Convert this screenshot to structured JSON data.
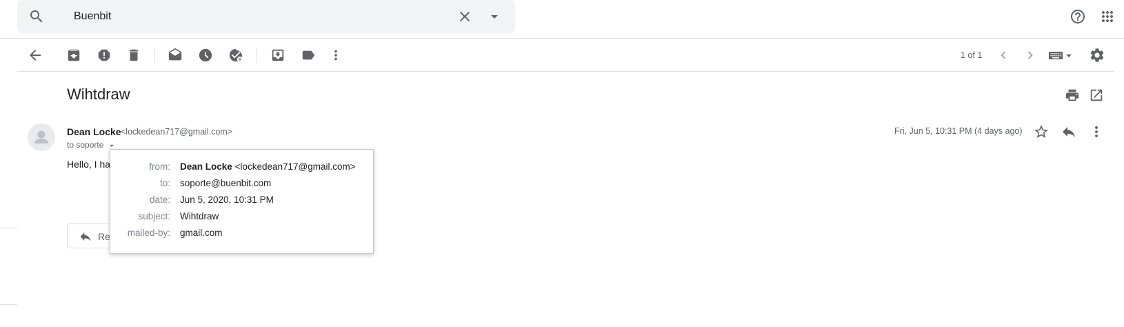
{
  "search": {
    "value": "Buenbit"
  },
  "toolbar": {
    "pager": "1 of 1"
  },
  "message": {
    "subject": "Wihtdraw",
    "sender_name": "Dean Locke",
    "sender_email": "<lockedean717@gmail.com>",
    "to_label": "to soporte",
    "date": "Fri, Jun 5, 10:31 PM (4 days ago)",
    "body_snippet": "Hello, I hav",
    "reply_label": "Re"
  },
  "details_popup": {
    "from_label": "from:",
    "from_name": "Dean Locke",
    "from_email": "<lockedean717@gmail.com>",
    "to_label": "to:",
    "to_value": "soporte@buenbit.com",
    "date_label": "date:",
    "date_value": "Jun 5, 2020, 10:31 PM",
    "subject_label": "subject:",
    "subject_value": "Wihtdraw",
    "mailed_by_label": "mailed-by:",
    "mailed_by_value": "gmail.com"
  },
  "icons": {
    "header": [
      "search-icon",
      "clear-icon",
      "search-options-icon",
      "help-icon",
      "apps-icon"
    ],
    "toolbar": [
      "back-icon",
      "archive-icon",
      "report-spam-icon",
      "delete-icon",
      "mark-unread-icon",
      "snooze-icon",
      "add-task-icon",
      "move-to-icon",
      "label-icon",
      "more-icon",
      "prev-icon",
      "next-icon",
      "keyboard-icon",
      "settings-icon"
    ],
    "message": [
      "print-icon",
      "open-new-window-icon",
      "star-icon",
      "reply-icon",
      "more-vert-icon"
    ]
  }
}
